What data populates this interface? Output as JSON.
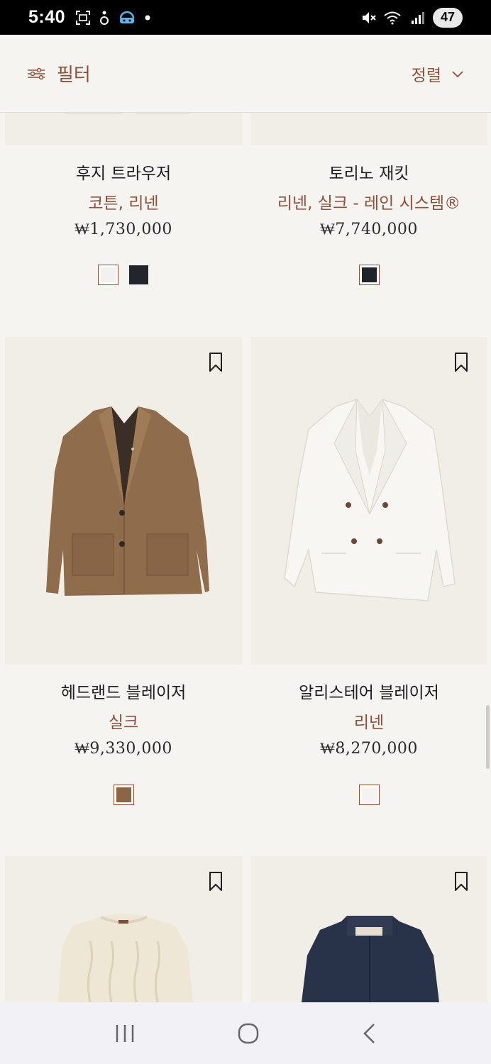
{
  "status_bar": {
    "time": "5:40",
    "battery": "47",
    "icons": [
      "screenshot-icon",
      "accessibility-icon",
      "vpn-icon",
      "dot-icon",
      "mute-icon",
      "wifi-icon",
      "signal-icon"
    ]
  },
  "header": {
    "filter_label": "필터",
    "filter_icon": "sliders-icon",
    "sort_label": "정렬",
    "sort_icon": "chevron-down-icon"
  },
  "products": [
    {
      "name": "후지 트라우저",
      "material": "코튼, 리넨",
      "price": "₩1,730,000",
      "swatches": [
        {
          "color": "#f2f1ef",
          "selected": true
        },
        {
          "color": "#23252c",
          "selected": false
        }
      ]
    },
    {
      "name": "토리노 재킷",
      "material": "리넨, 실크 - 레인 시스템®",
      "price": "₩7,740,000",
      "swatches": [
        {
          "color": "#202329",
          "selected": true
        }
      ]
    },
    {
      "name": "헤드랜드 블레이저",
      "material": "실크",
      "price": "₩9,330,000",
      "swatches": [
        {
          "color": "#8c6548",
          "selected": true
        }
      ]
    },
    {
      "name": "알리스테어 블레이저",
      "material": "리넨",
      "price": "₩8,270,000",
      "swatches": [
        {
          "color": "#f4f3f0",
          "selected": true
        }
      ]
    }
  ],
  "bottom_products": [
    {
      "image": "cable-knit-sweater"
    },
    {
      "image": "navy-field-jacket"
    }
  ],
  "nav": {
    "icons": [
      "recent-apps-icon",
      "home-icon",
      "back-icon"
    ]
  },
  "colors": {
    "accent": "#8e4f3b",
    "background": "#f6f4f0",
    "image_bg": "#f1ede7"
  }
}
